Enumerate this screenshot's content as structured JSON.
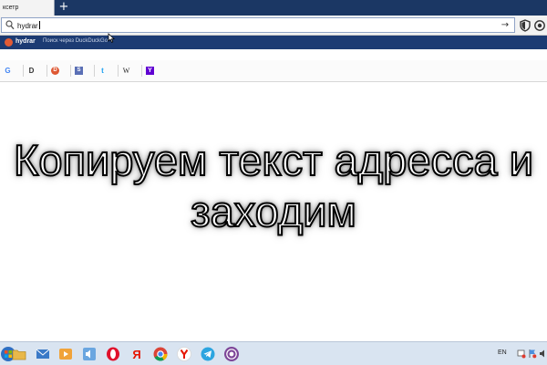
{
  "browser": {
    "tab_title": "ксетр",
    "tab_close": "×",
    "new_tab": "+",
    "url_value": "hydrar",
    "go_button": "→",
    "suggestion": {
      "query": "hydrar",
      "description": "Поиск через DuckDuckGo"
    },
    "quick_sites": [
      {
        "name": "google-site",
        "glyph": "G",
        "color": "#4285f4"
      },
      {
        "name": "disconnect-site",
        "glyph": "D",
        "color": "#333333"
      },
      {
        "name": "duckduckgo-site",
        "glyph": "D",
        "color": "#de5833"
      },
      {
        "name": "startpage-site",
        "glyph": "S",
        "color": "#5a6fb5"
      },
      {
        "name": "twitter-site",
        "glyph": "t",
        "color": "#1da1f2"
      },
      {
        "name": "wikipedia-site",
        "glyph": "W",
        "color": "#222222"
      },
      {
        "name": "yahoo-site",
        "glyph": "Y",
        "color": "#6001d2"
      }
    ]
  },
  "caption": {
    "line1": "Копируем текст адресса и",
    "line2": "заходим"
  },
  "taskbar": {
    "language": "EN",
    "apps": [
      "start-button",
      "folder-app",
      "mail-app",
      "media-app",
      "volume-app",
      "opera-app",
      "yandex-app",
      "chrome-app",
      "yandex-browser-app",
      "telegram-app",
      "tor-app"
    ]
  }
}
